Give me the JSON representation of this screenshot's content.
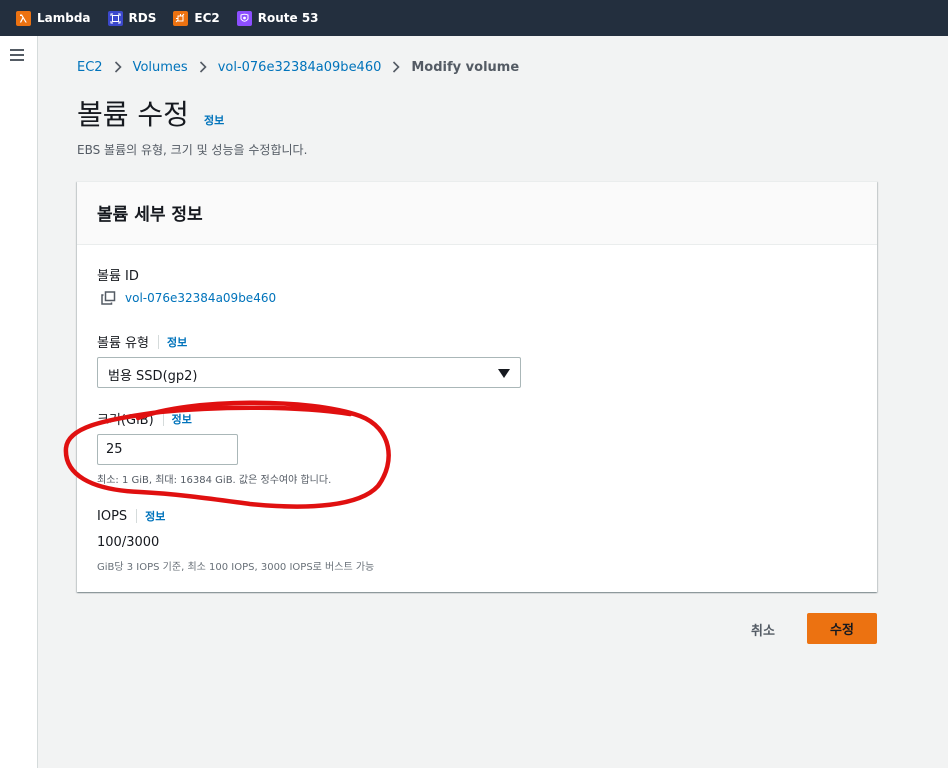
{
  "favorites": [
    {
      "label": "Lambda",
      "icon": "lambda-icon",
      "color": "#ec7211"
    },
    {
      "label": "RDS",
      "icon": "rds-icon",
      "color": "#3b48cc"
    },
    {
      "label": "EC2",
      "icon": "ec2-icon",
      "color": "#ec7211"
    },
    {
      "label": "Route 53",
      "icon": "route53-icon",
      "color": "#8c4fff"
    }
  ],
  "breadcrumb": {
    "items": [
      "EC2",
      "Volumes",
      "vol-076e32384a09be460"
    ],
    "current": "Modify volume"
  },
  "header": {
    "title": "볼륨 수정",
    "info": "정보",
    "description": "EBS 볼륨의 유형, 크기 및 성능을 수정합니다."
  },
  "panel": {
    "title": "볼륨 세부 정보",
    "volume_id": {
      "label": "볼륨 ID",
      "value": "vol-076e32384a09be460"
    },
    "volume_type": {
      "label": "볼륨 유형",
      "info": "정보",
      "selected": "범용 SSD(gp2)"
    },
    "size": {
      "label": "크기(GiB)",
      "info": "정보",
      "value": "25",
      "constraint": "최소: 1 GiB, 최대: 16384 GiB. 값은 정수여야 합니다."
    },
    "iops": {
      "label": "IOPS",
      "info": "정보",
      "value": "100/3000",
      "description": "GiB당 3 IOPS 기준, 최소 100 IOPS, 3000 IOPS로 버스트 가능"
    }
  },
  "actions": {
    "cancel": "취소",
    "submit": "수정"
  },
  "colors": {
    "accent": "#ec7211",
    "link": "#0073bb",
    "annotation": "#e01010"
  }
}
